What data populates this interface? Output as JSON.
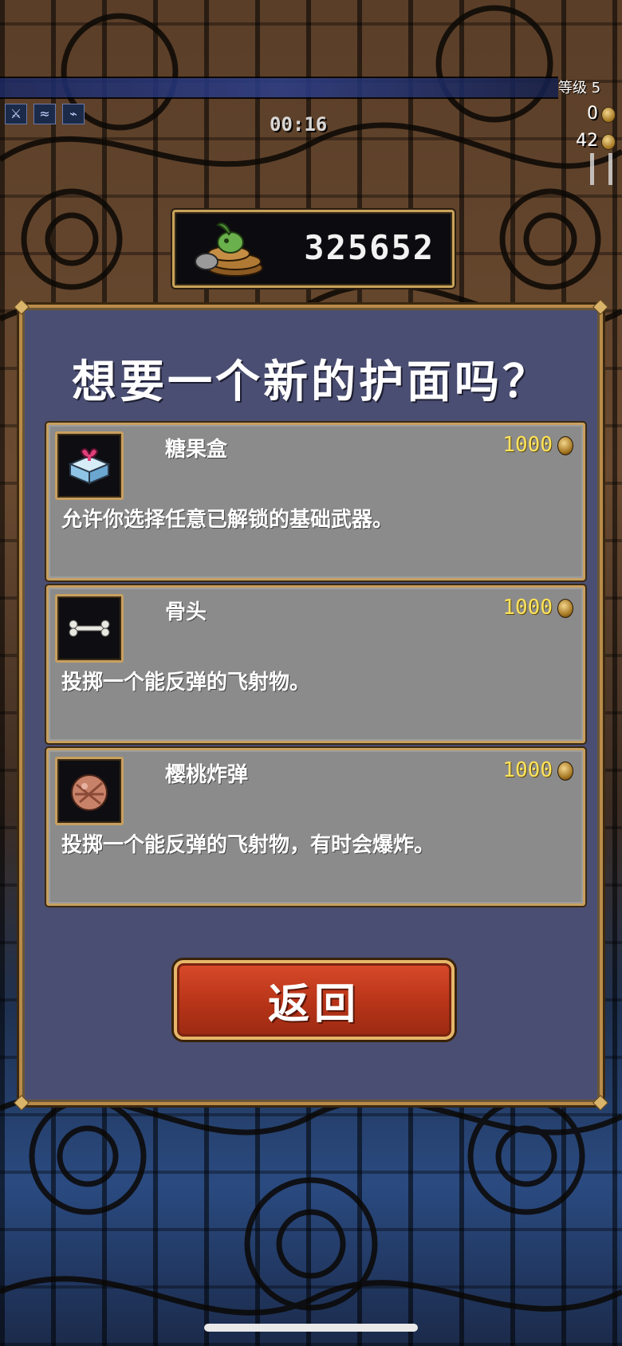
{
  "hud": {
    "timer": "00:16",
    "level": "等级 5",
    "kills": "0",
    "coins": "42",
    "weapon_icons": [
      "sword-icon",
      "whip-icon",
      "wand-icon"
    ]
  },
  "gold": {
    "amount": "325652",
    "icon": "gold-pile-icon"
  },
  "panel": {
    "title": "想要一个新的护面吗？",
    "items": [
      {
        "name": "糖果盒",
        "price": "1000",
        "description": "允许你选择任意已解锁的基础武器。",
        "icon": "candy-box-icon"
      },
      {
        "name": "骨头",
        "price": "1000",
        "description": "投掷一个能反弹的飞射物。",
        "icon": "bone-icon"
      },
      {
        "name": "樱桃炸弹",
        "price": "1000",
        "description": "投掷一个能反弹的飞射物，有时会爆炸。",
        "icon": "cherry-bomb-icon"
      }
    ],
    "back_label": "返回"
  },
  "colors": {
    "panel_bg": "#4a4e72",
    "card_bg": "#8b8b8b",
    "border_gold": "#c8a060",
    "price_yellow": "#ffe35a",
    "button_red": "#b73418"
  }
}
